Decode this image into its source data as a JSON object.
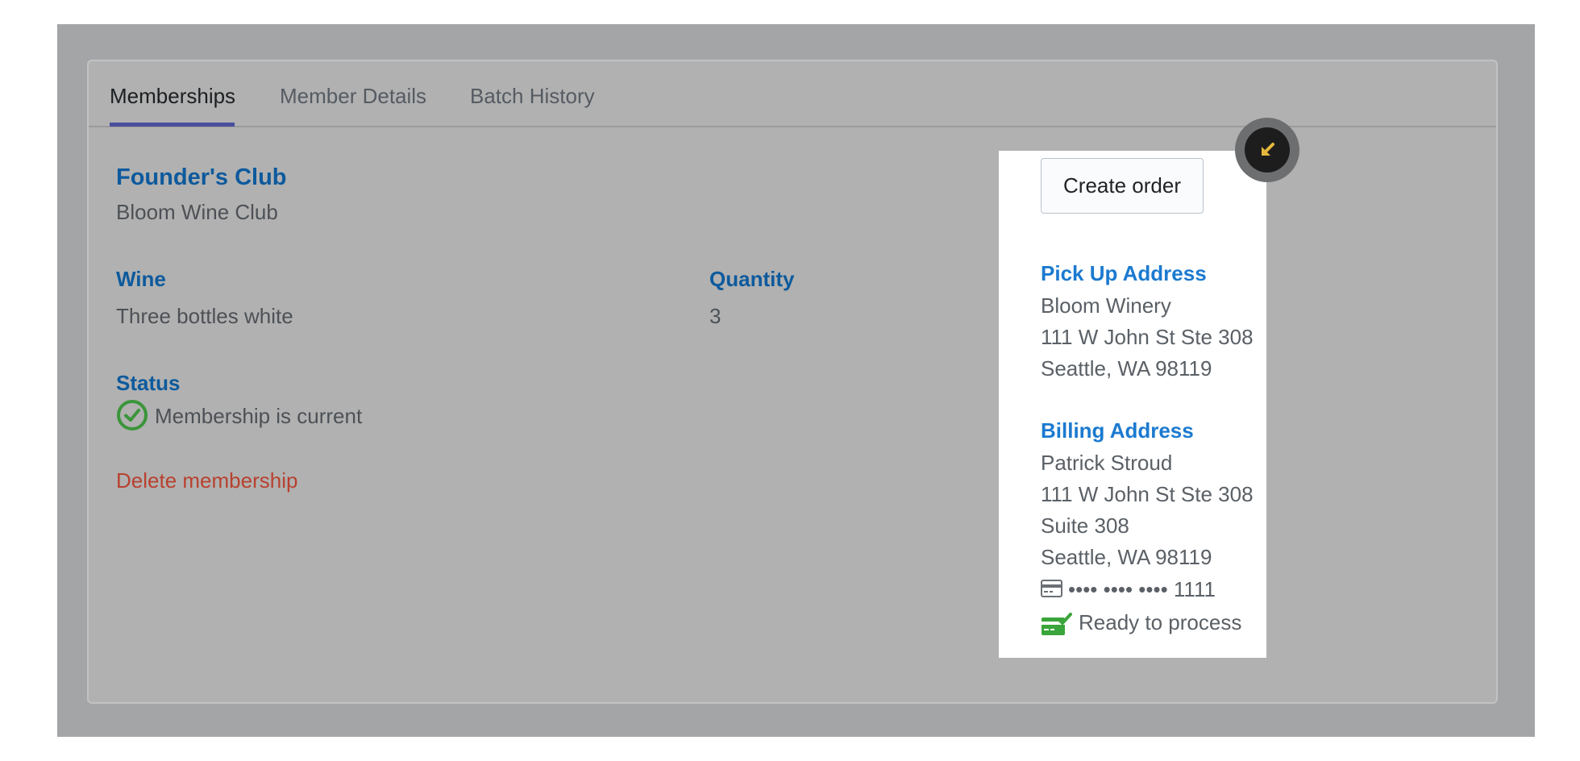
{
  "tabs": [
    {
      "label": "Memberships",
      "active": true
    },
    {
      "label": "Member Details",
      "active": false
    },
    {
      "label": "Batch History",
      "active": false
    }
  ],
  "membership": {
    "club_name": "Founder's Club",
    "winery_club": "Bloom Wine Club",
    "wine_label": "Wine",
    "wine_value": "Three bottles white",
    "quantity_label": "Quantity",
    "quantity_value": "3",
    "status_label": "Status",
    "status_value": "Membership is current",
    "delete_label": "Delete membership"
  },
  "panel": {
    "create_order_label": "Create order",
    "pickup": {
      "label": "Pick Up Address",
      "lines": [
        "Bloom Winery",
        "111 W John St Ste 308",
        "Seattle, WA 98119"
      ]
    },
    "billing": {
      "label": "Billing Address",
      "lines": [
        "Patrick Stroud",
        "111 W John St Ste 308",
        "Suite 308",
        "Seattle, WA 98119"
      ],
      "card_masked": "•••• •••• •••• 1111",
      "card_status": "Ready to process"
    }
  },
  "icons": {
    "status": "check-circle-icon",
    "card": "credit-card-icon",
    "ready": "card-check-icon",
    "fab": "arrow-down-left-icon"
  },
  "colors": {
    "accent_blue": "#0d5a9d",
    "link_blue": "#1b7ad0",
    "success_green": "#3aa53a",
    "danger_red": "#b8412f",
    "tab_indicator": "#4a4f9c",
    "fab_arrow": "#e5b73b"
  }
}
